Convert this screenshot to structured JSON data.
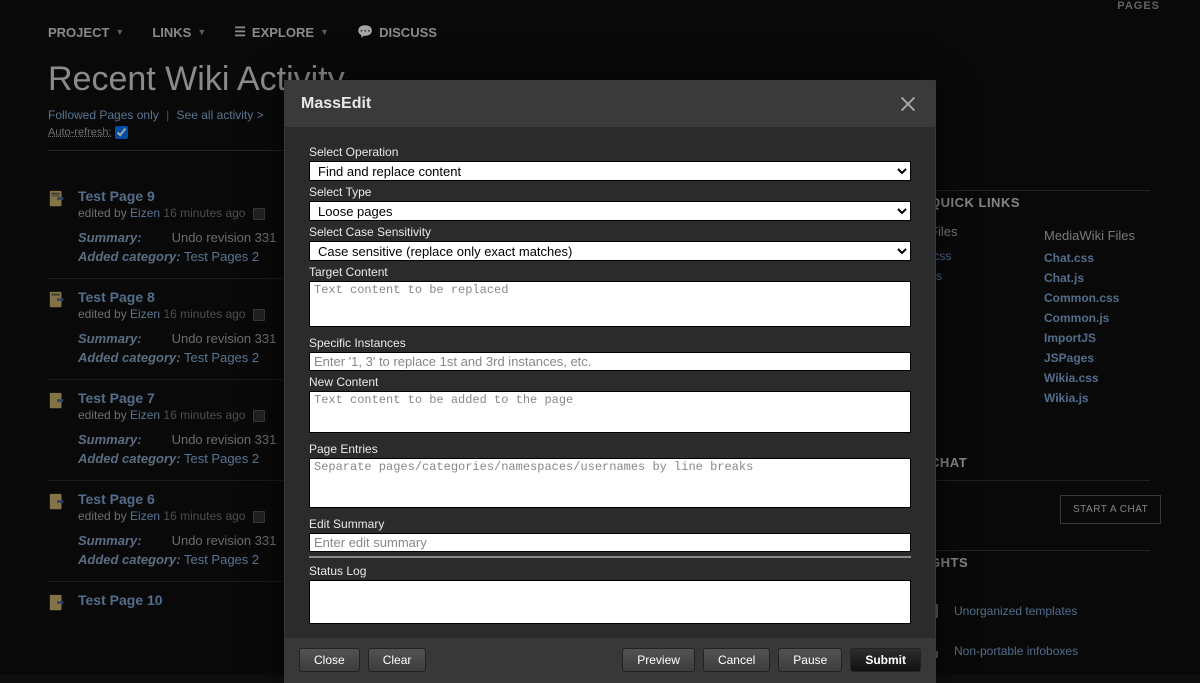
{
  "topbar": {
    "pages": "PAGES"
  },
  "nav": {
    "project": "PROJECT",
    "links": "LINKS",
    "explore": "EXPLORE",
    "discuss": "DISCUSS"
  },
  "page": {
    "title": "Recent Wiki Activity",
    "followed": "Followed Pages only",
    "seeall": "See all activity >",
    "autorefresh": "Auto-refresh:"
  },
  "activity": [
    {
      "title": "Test Page 9",
      "by": "edited by",
      "user": "Eizen",
      "time": "16 minutes ago",
      "summary_lbl": "Summary:",
      "summary": "Undo revision 331",
      "cat_lbl": "Added category:",
      "cat": "Test Pages 2"
    },
    {
      "title": "Test Page 8",
      "by": "edited by",
      "user": "Eizen",
      "time": "16 minutes ago",
      "summary_lbl": "Summary:",
      "summary": "Undo revision 331",
      "cat_lbl": "Added category:",
      "cat": "Test Pages 2"
    },
    {
      "title": "Test Page 7",
      "by": "edited by",
      "user": "Eizen",
      "time": "16 minutes ago",
      "summary_lbl": "Summary:",
      "summary": "Undo revision 331",
      "cat_lbl": "Added category:",
      "cat": "Test Pages 2"
    },
    {
      "title": "Test Page 6",
      "by": "edited by",
      "user": "Eizen",
      "time": "16 minutes ago",
      "summary_lbl": "Summary:",
      "summary": "Undo revision 331",
      "cat_lbl": "Added category:",
      "cat": "Test Pages 2"
    },
    {
      "title": "Test Page 10",
      "by": "",
      "user": "",
      "time": "",
      "summary_lbl": "",
      "summary": "",
      "cat_lbl": "",
      "cat": ""
    }
  ],
  "right": {
    "quicklinks": "QUICK LINKS",
    "files_hdr": "Files",
    "mw_hdr": "MediaWiki Files",
    "partial": [
      ".css",
      ".js",
      "s"
    ],
    "mw": [
      "Chat.css",
      "Chat.js",
      "Common.css",
      "Common.js",
      "ImportJS",
      "JSPages",
      "Wikia.css",
      "Wikia.js"
    ],
    "chat_hdr": "CHAT",
    "start_chat": "START A CHAT",
    "insights_hdr": "GHTS",
    "ins1": "Unorganized templates",
    "ins2": "Non-portable infoboxes"
  },
  "modal": {
    "title": "MassEdit",
    "labels": {
      "op": "Select Operation",
      "type": "Select Type",
      "case": "Select Case Sensitivity",
      "target": "Target Content",
      "specific": "Specific Instances",
      "newc": "New Content",
      "pages": "Page Entries",
      "editsum": "Edit Summary",
      "status": "Status Log"
    },
    "values": {
      "op": "Find and replace content",
      "type": "Loose pages",
      "case": "Case sensitive (replace only exact matches)"
    },
    "placeholders": {
      "target": "Text content to be replaced",
      "specific": "Enter '1, 3' to replace 1st and 3rd instances, etc.",
      "newc": "Text content to be added to the page",
      "pages": "Separate pages/categories/namespaces/usernames by line breaks",
      "editsum": "Enter edit summary"
    },
    "buttons": {
      "close": "Close",
      "clear": "Clear",
      "preview": "Preview",
      "cancel": "Cancel",
      "pause": "Pause",
      "submit": "Submit"
    }
  }
}
